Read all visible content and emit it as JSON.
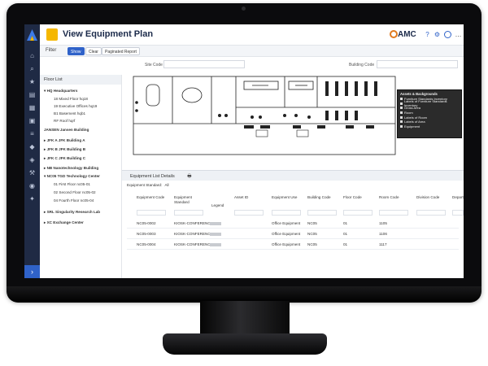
{
  "app": {
    "title": "View Equipment Plan",
    "brand": "AMC"
  },
  "colors": {
    "accent": "#2f62c9",
    "rail": "#1f2a44",
    "app_icon": "#f5b700"
  },
  "rail": {
    "icons": [
      "home-icon",
      "search-icon",
      "star-icon",
      "document-icon",
      "grid-icon",
      "calendar-icon",
      "list-icon",
      "tag-icon",
      "layers-icon",
      "wrench-icon",
      "eye-icon",
      "settings-icon"
    ],
    "expand": "›"
  },
  "filter": {
    "label": "Filter",
    "show": "Show",
    "clear": "Clear",
    "paginated": "Paginated Report"
  },
  "site": {
    "site_label": "Site Code",
    "building_label": "Building Code"
  },
  "floor_list": {
    "title": "Floor List",
    "items": [
      "HQ Headquarters",
      "18 Mixed Floor hq18",
      "19 Executive Offices hq19",
      "B1 Basement hqb1",
      "RF Roof hqrf",
      "JANSEN Jansen Building",
      "JFK A JFK Building A",
      "JFK B JFK Building B",
      "JFK C JFK Building C",
      "NB Nanotechnology Building",
      "NC05 TGD Technology Center",
      "01 First Floor nc05-01",
      "02 Second Floor nc05-02",
      "04 Fourth Floor nc05-04",
      "SRL Singularity Research Lab",
      "XC Exchange Center"
    ]
  },
  "layers": {
    "title": "Assets & Backgrounds",
    "items": [
      "Furniture Standards Inventory",
      "Labels of Furniture Standards Inventory",
      "Gross Area",
      "Room",
      "Labels of Room",
      "Labels of Area",
      "Equipment"
    ]
  },
  "details": {
    "title": "Equipment List Details",
    "standard_label": "Equipment Standard:",
    "standard_value": "All",
    "columns": [
      "Equipment Code",
      "Equipment Standard",
      "Legend",
      "Asset ID",
      "Equipment Use",
      "Building Code",
      "Floor Code",
      "Room Code",
      "Division Code",
      "Department Code"
    ],
    "rows": [
      [
        "NC05-0002",
        "KIOSK-CONFERENCE",
        "",
        "",
        "Office Equipment",
        "NC05",
        "01",
        "1105",
        "",
        ""
      ],
      [
        "NC05-0003",
        "KIOSK-CONFERENCE",
        "",
        "",
        "Office Equipment",
        "NC05",
        "01",
        "1106",
        "",
        ""
      ],
      [
        "NC05-0004",
        "KIOSK-CONFERENCE",
        "",
        "",
        "Office Equipment",
        "NC05",
        "01",
        "1117",
        "",
        ""
      ]
    ]
  }
}
